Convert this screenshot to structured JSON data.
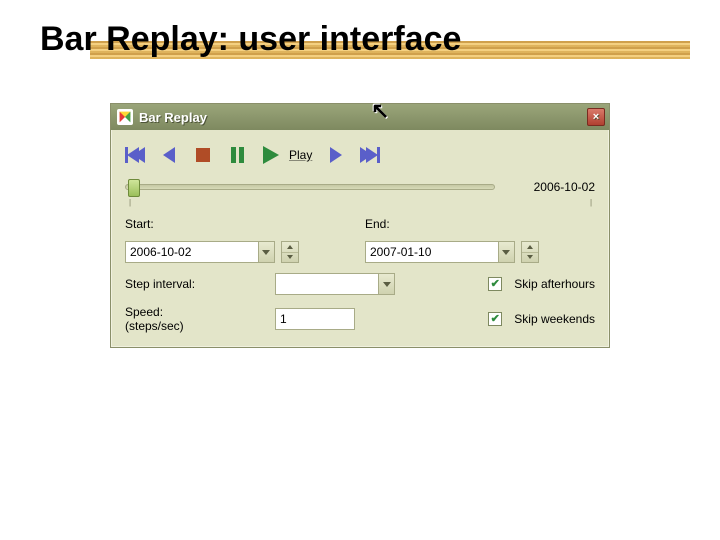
{
  "slide": {
    "title": "Bar Replay: user interface"
  },
  "window": {
    "title": "Bar Replay",
    "close_glyph": "×"
  },
  "transport": {
    "play_label": "Play"
  },
  "slider": {
    "value_label": "2006-10-02"
  },
  "fields": {
    "start_label": "Start:",
    "start_value": "2006-10-02",
    "end_label": "End:",
    "end_value": "2007-01-10",
    "step_label": "Step interval:",
    "step_value": "",
    "speed_label_l1": "Speed:",
    "speed_label_l2": "(steps/sec)",
    "speed_value": "1"
  },
  "checks": {
    "skip_afterhours_label": "Skip afterhours",
    "skip_afterhours_checked": true,
    "skip_weekends_label": "Skip weekends",
    "skip_weekends_checked": true
  }
}
